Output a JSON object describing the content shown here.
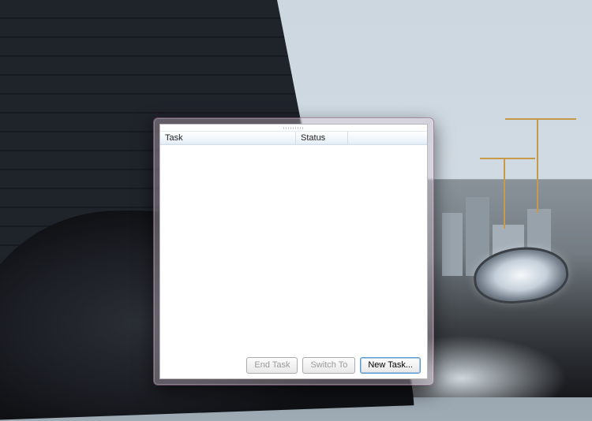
{
  "columns": {
    "task": "Task",
    "status": "Status"
  },
  "tasks": [],
  "buttons": {
    "end_task": "End Task",
    "switch_to": "Switch To",
    "new_task": "New Task..."
  }
}
